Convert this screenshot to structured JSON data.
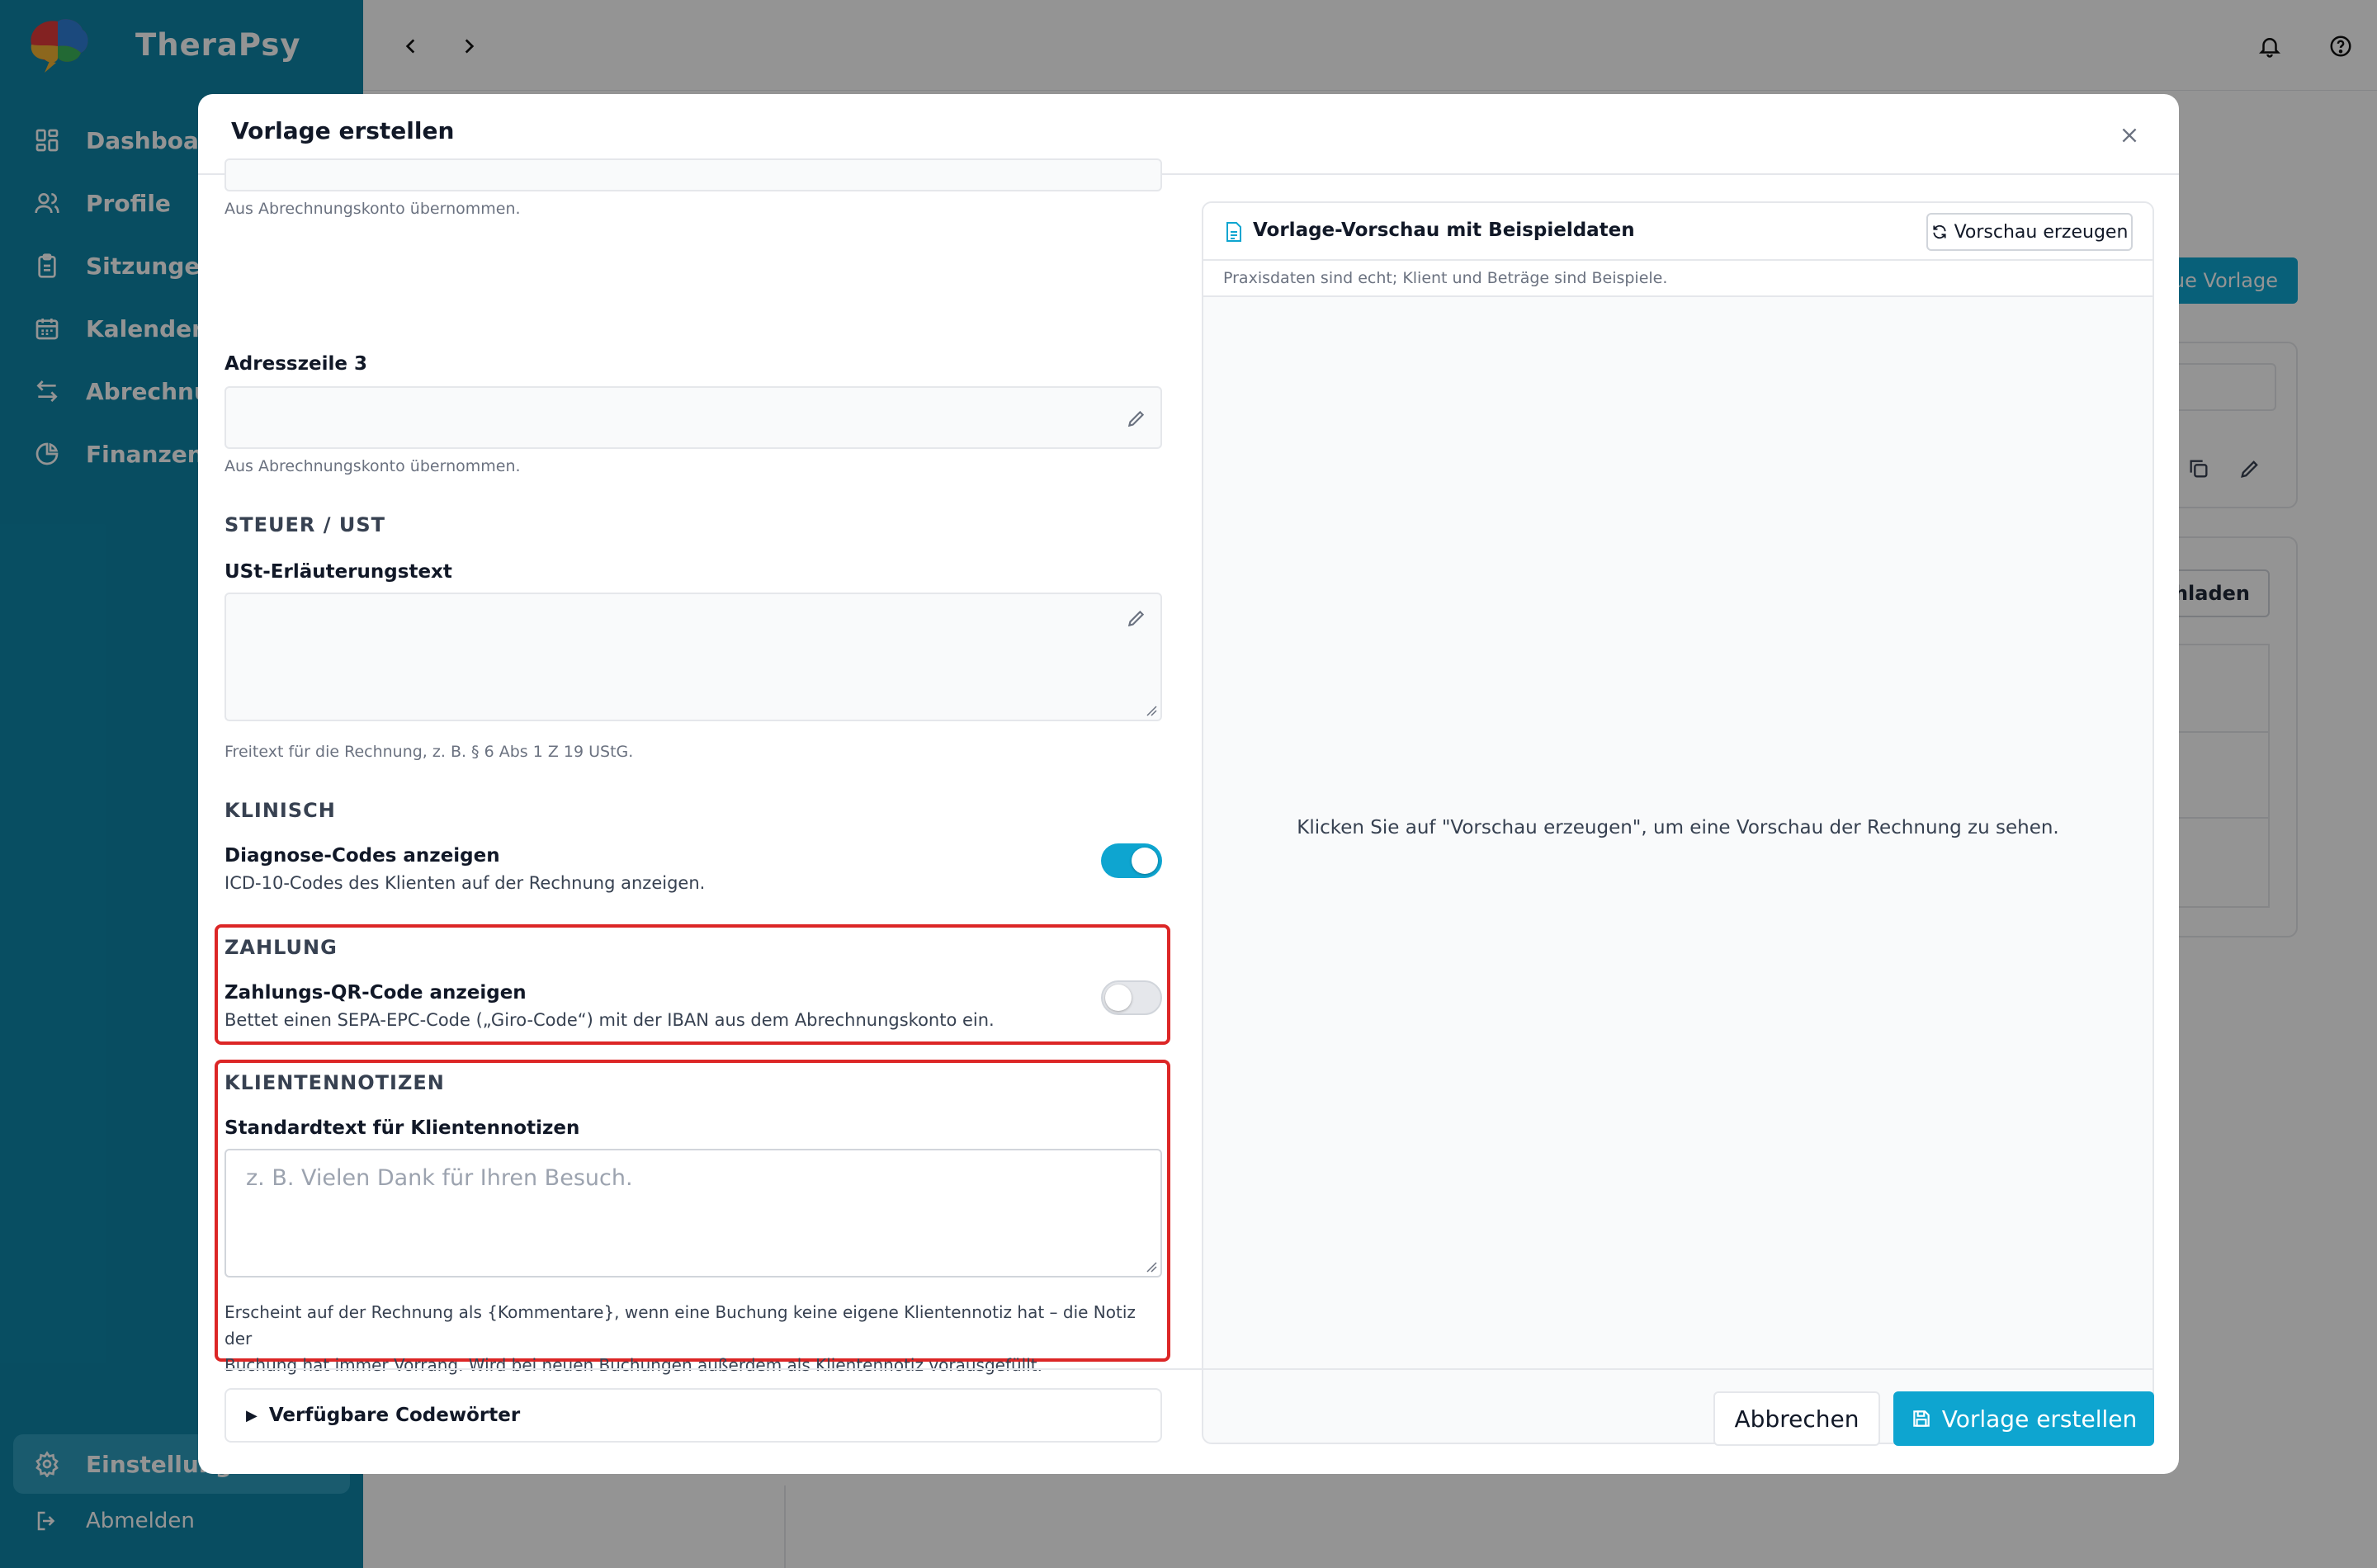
{
  "app": {
    "name": "TheraPsy"
  },
  "sidebar": {
    "items": [
      {
        "label": "Dashboard",
        "icon": "dashboard-grid-icon"
      },
      {
        "label": "Profile",
        "icon": "users-icon"
      },
      {
        "label": "Sitzungen",
        "icon": "clipboard-icon"
      },
      {
        "label": "Kalender",
        "icon": "calendar-icon"
      },
      {
        "label": "Abrechnung",
        "icon": "arrows-exchange-icon"
      },
      {
        "label": "Finanzen",
        "icon": "pie-chart-icon"
      }
    ],
    "settings_label": "Einstellungen",
    "logout_label": "Abmelden"
  },
  "background": {
    "new_template_button": "ue Vorlage",
    "download_button": "chladen"
  },
  "modal": {
    "title": "Vorlage erstellen",
    "address2_hint": "Aus Abrechnungskonto übernommen.",
    "address3_label": "Adresszeile 3",
    "address3_hint": "Aus Abrechnungskonto übernommen.",
    "tax_section": "STEUER / UST",
    "vat_text_label": "USt-Erläuterungstext",
    "vat_text_hint": "Freitext für die Rechnung, z. B. § 6 Abs 1 Z 19 UStG.",
    "clinical_section": "KLINISCH",
    "diagnosis_label": "Diagnose-Codes anzeigen",
    "diagnosis_desc": "ICD-10-Codes des Klienten auf der Rechnung anzeigen.",
    "diagnosis_enabled": true,
    "payment_section": "ZAHLUNG",
    "qr_label": "Zahlungs-QR-Code anzeigen",
    "qr_desc": "Bettet einen SEPA-EPC-Code („Giro-Code“) mit der IBAN aus dem Abrechnungskonto ein.",
    "qr_enabled": false,
    "notes_section": "KLIENTENNOTIZEN",
    "notes_label": "Standardtext für Klientennotizen",
    "notes_placeholder": "z. B. Vielen Dank für Ihren Besuch.",
    "notes_hint_1": "Erscheint auf der Rechnung als {Kommentare}, wenn eine Buchung keine eigene Klientennotiz hat – die Notiz der",
    "notes_hint_2": "Buchung hat immer Vorrang. Wird bei neuen Buchungen außerdem als Klientennotiz vorausgefüllt.",
    "codewords_label": "Verfügbare Codewörter",
    "preview_title": "Vorlage-Vorschau mit Beispieldaten",
    "preview_button": "Vorschau erzeugen",
    "preview_sub": "Praxisdaten sind echt; Klient und Beträge sind Beispiele.",
    "preview_empty": "Klicken Sie auf \"Vorschau erzeugen\", um eine Vorschau der Rechnung zu sehen.",
    "cancel_button": "Abbrechen",
    "create_button": "Vorlage erstellen"
  },
  "colors": {
    "sidebar": "#0e86a8",
    "accent": "#0ea5d0",
    "highlight": "#dc2626"
  }
}
